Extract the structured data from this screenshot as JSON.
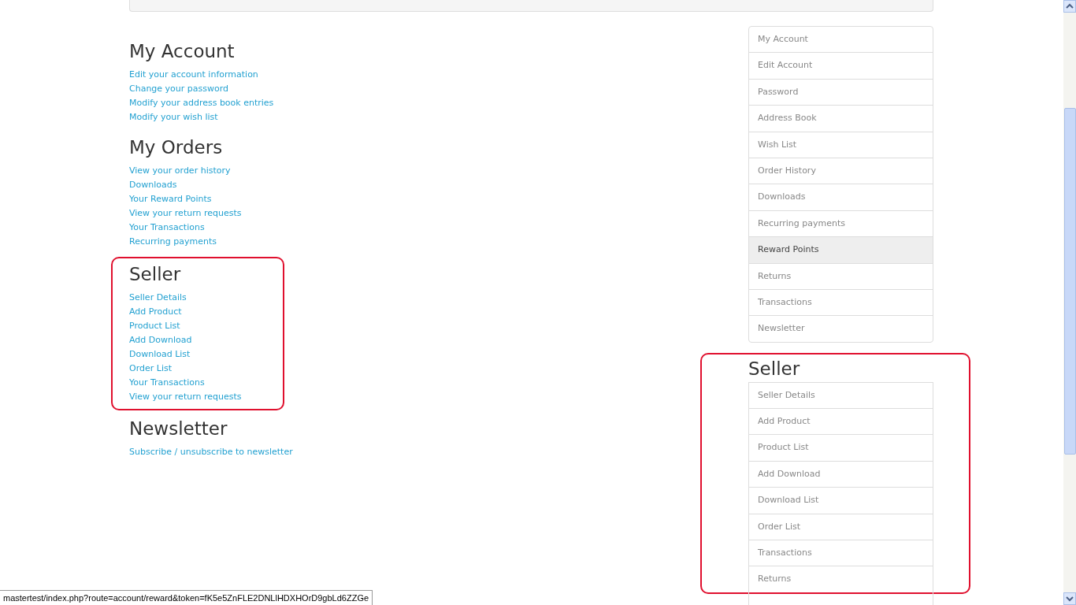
{
  "sections": [
    {
      "title": "My Account",
      "highlighted": false,
      "links": [
        "Edit your account information",
        "Change your password",
        "Modify your address book entries",
        "Modify your wish list"
      ]
    },
    {
      "title": "My Orders",
      "highlighted": false,
      "links": [
        "View your order history",
        "Downloads",
        "Your Reward Points",
        "View your return requests",
        "Your Transactions",
        "Recurring payments"
      ]
    },
    {
      "title": "Seller",
      "highlighted": true,
      "links": [
        "Seller Details",
        "Add Product",
        "Product List",
        "Add Download",
        "Download List",
        "Order List",
        "Your Transactions",
        "View your return requests"
      ]
    },
    {
      "title": "Newsletter",
      "highlighted": false,
      "links": [
        "Subscribe / unsubscribe to newsletter"
      ]
    }
  ],
  "sidebar": {
    "items": [
      {
        "label": "My Account",
        "selected": false
      },
      {
        "label": "Edit Account",
        "selected": false
      },
      {
        "label": "Password",
        "selected": false
      },
      {
        "label": "Address Book",
        "selected": false
      },
      {
        "label": "Wish List",
        "selected": false
      },
      {
        "label": "Order History",
        "selected": false
      },
      {
        "label": "Downloads",
        "selected": false
      },
      {
        "label": "Recurring payments",
        "selected": false
      },
      {
        "label": "Reward Points",
        "selected": true
      },
      {
        "label": "Returns",
        "selected": false
      },
      {
        "label": "Transactions",
        "selected": false
      },
      {
        "label": "Newsletter",
        "selected": false
      }
    ]
  },
  "seller_sidebar": {
    "title": "Seller",
    "highlighted": true,
    "items": [
      {
        "label": "Seller Details",
        "selected": false
      },
      {
        "label": "Add Product",
        "selected": false
      },
      {
        "label": "Product List",
        "selected": false
      },
      {
        "label": "Add Download",
        "selected": false
      },
      {
        "label": "Download List",
        "selected": false
      },
      {
        "label": "Order List",
        "selected": false
      },
      {
        "label": "Transactions",
        "selected": false
      },
      {
        "label": "Returns",
        "selected": false
      }
    ]
  },
  "status_bar": {
    "url": "mastertest/index.php?route=account/reward&token=fK5e5ZnFLE2DNLlHDXHOrD9gbLd6ZZGe"
  }
}
